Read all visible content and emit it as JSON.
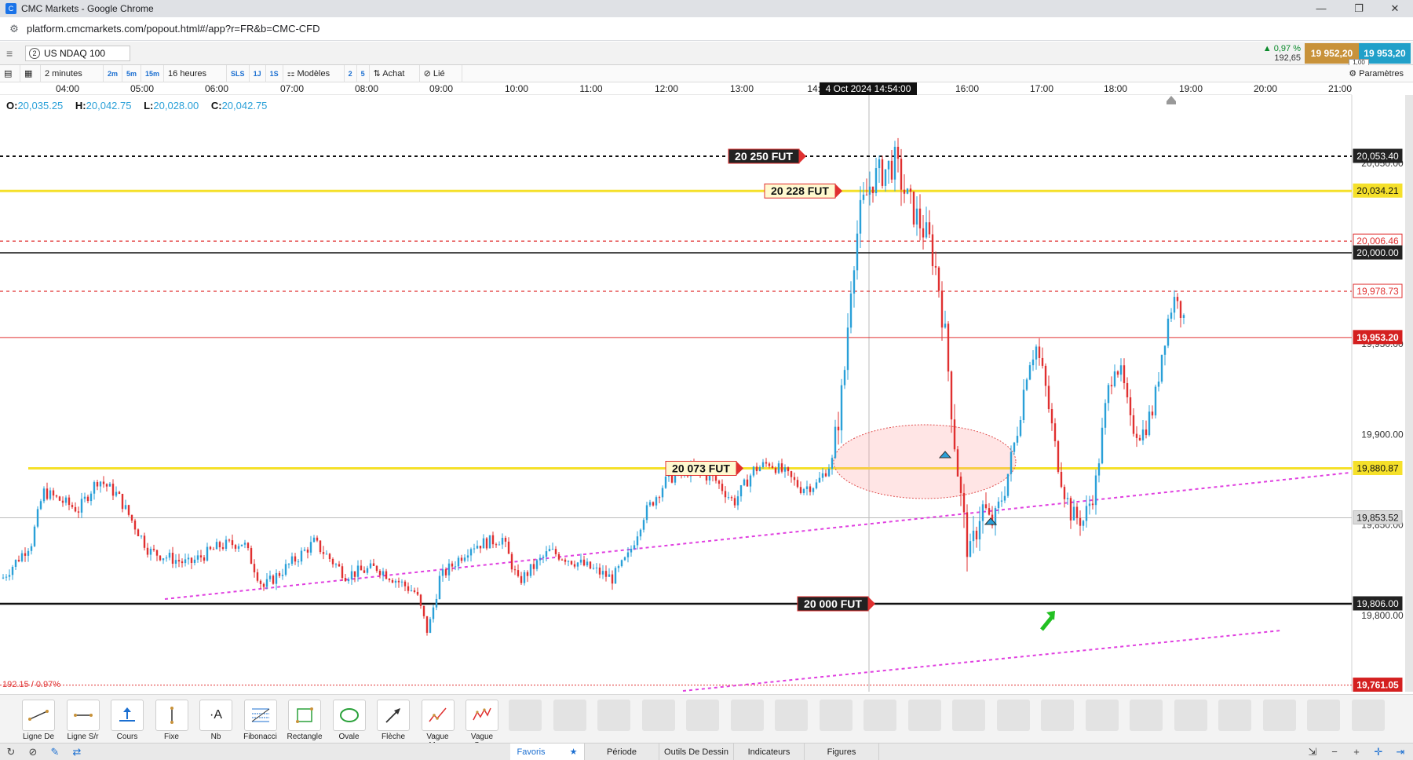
{
  "window": {
    "title": "CMC Markets - Google Chrome",
    "minimize": "—",
    "restore": "❐",
    "close": "✕"
  },
  "address": {
    "url": "platform.cmcmarkets.com/popout.html#/app?r=FR&b=CMC-CFD"
  },
  "instrument": {
    "index_badge": "2",
    "name": "US NDAQ 100",
    "change_pct": "▲ 0,97 %",
    "change_abs": "192,65",
    "sell": "19 952,20",
    "buy": "19 953,20",
    "spread": "1,00"
  },
  "toolbar": {
    "interval": "2 minutes",
    "btn_2m": "2m",
    "btn_5m": "5m",
    "btn_15m": "15m",
    "range": "16 heures",
    "sls": "SLS",
    "btn_1j": "1J",
    "btn_1s": "1S",
    "templates": "Modèles",
    "n2": "2",
    "n5": "5",
    "buy": "Achat",
    "link": "Lié",
    "settings": "Paramètres"
  },
  "time_axis": {
    "ticks": [
      "04:00",
      "05:00",
      "06:00",
      "07:00",
      "08:00",
      "09:00",
      "10:00",
      "11:00",
      "12:00",
      "13:00",
      "14:0",
      "16:00",
      "17:00",
      "18:00",
      "19:00",
      "20:00",
      "21:00"
    ],
    "cursor_label": "4 Oct 2024 14:54:00"
  },
  "ohlc": {
    "o_label": "O:",
    "o": "20,035.25",
    "h_label": "H:",
    "h": "20,042.75",
    "l_label": "L:",
    "l": "20,028.00",
    "c_label": "C:",
    "c": "20,042.75"
  },
  "chart_data": {
    "type": "candlestick",
    "ylim": [
      19752,
      20105
    ],
    "y_ticks": [
      "20,050.00",
      "19,950.00",
      "19,900.00",
      "19,850.00",
      "19,800.00"
    ],
    "price_labels": [
      {
        "text": "20,053.40",
        "value": 20053.4,
        "style": "dark"
      },
      {
        "text": "20,034.21",
        "value": 20034.21,
        "style": "yellow"
      },
      {
        "text": "20,006.46",
        "value": 20006.46,
        "style": "red-outline"
      },
      {
        "text": "20,000.00",
        "value": 20000,
        "style": "dark"
      },
      {
        "text": "19,978.73",
        "value": 19978.73,
        "style": "red-outline"
      },
      {
        "text": "19,953.20",
        "value": 19953.2,
        "style": "red"
      },
      {
        "text": "19,880.87",
        "value": 19880.87,
        "style": "yellow"
      },
      {
        "text": "19,853.52",
        "value": 19853.52,
        "style": "grey"
      },
      {
        "text": "19,806.00",
        "value": 19806,
        "style": "dark"
      },
      {
        "text": "19,761.05",
        "value": 19761.05,
        "style": "red"
      }
    ],
    "annotations": [
      {
        "text": "20 250 FUT",
        "value": 20053.4,
        "color": "#e03030"
      },
      {
        "text": "20 228 FUT",
        "value": 20034.21,
        "color": "#e03030"
      },
      {
        "text": "20 073 FUT",
        "value": 19880.87,
        "color": "#e03030"
      },
      {
        "text": "20 000 FUT",
        "value": 19806,
        "color": "#e03030"
      }
    ],
    "pct_label": "192.15 / 0.97%",
    "up_color": "#2aa0d8",
    "down_color": "#e03030"
  },
  "drawing_tools": [
    {
      "label": "Ligne De ...",
      "icon": "line-icon"
    },
    {
      "label": "Ligne S/r",
      "icon": "sr-line-icon"
    },
    {
      "label": "Cours",
      "icon": "price-icon"
    },
    {
      "label": "Fixe",
      "icon": "fixed-icon"
    },
    {
      "label": "Nb",
      "icon": "note-icon"
    },
    {
      "label": "Fibonacci",
      "icon": "fibonacci-icon"
    },
    {
      "label": "Rectangle",
      "icon": "rectangle-icon"
    },
    {
      "label": "Ovale",
      "icon": "oval-icon"
    },
    {
      "label": "Flèche",
      "icon": "arrow-icon"
    },
    {
      "label": "Vague Mo...",
      "icon": "wave-icon"
    },
    {
      "label": "Vague Co...",
      "icon": "wave-corrective-icon"
    }
  ],
  "statusbar": {
    "tabs": [
      "Favoris",
      "Période",
      "Outils De Dessin",
      "Indicateurs",
      "Figures"
    ]
  }
}
